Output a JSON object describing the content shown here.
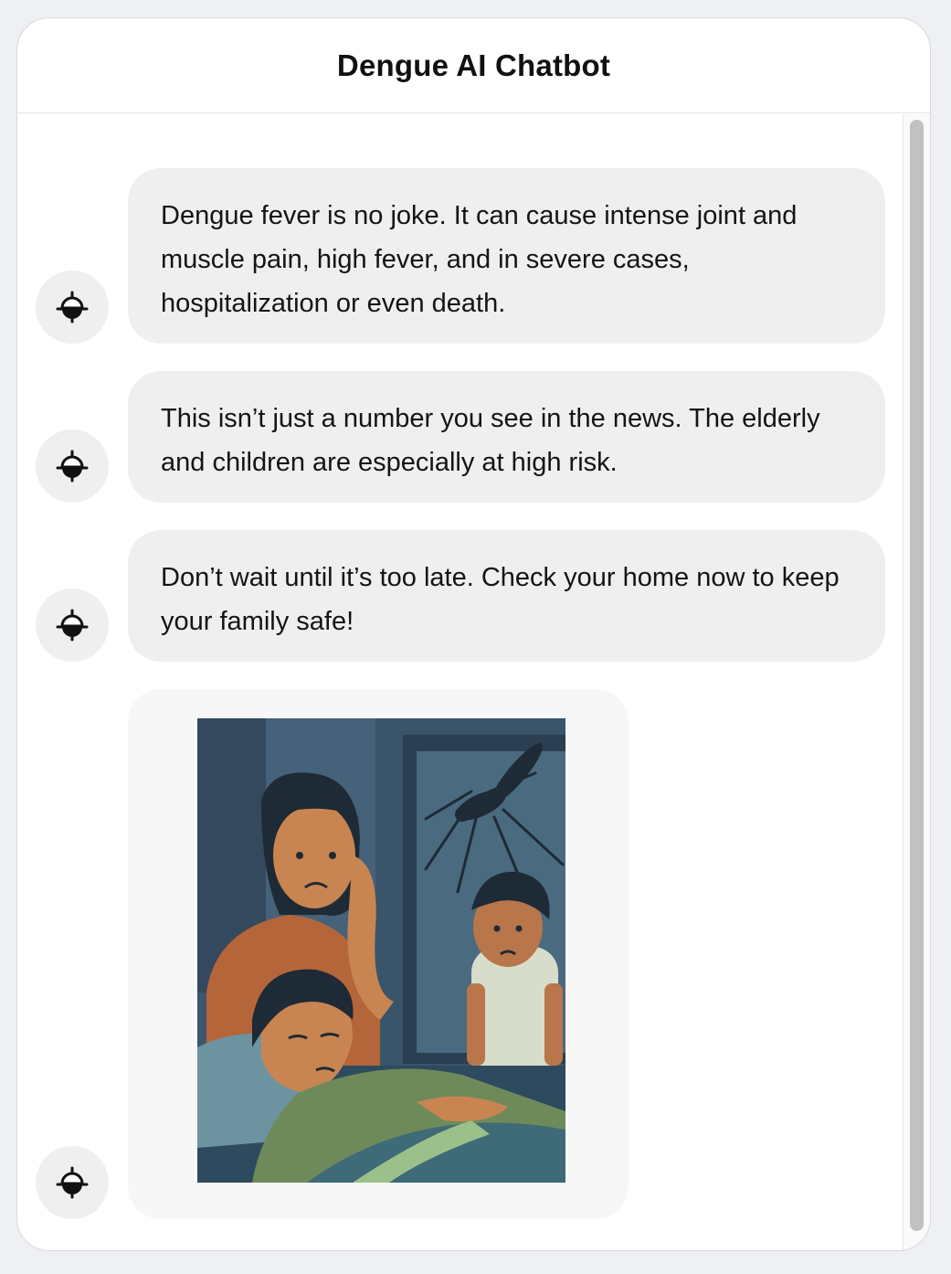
{
  "header": {
    "title": "Dengue AI Chatbot"
  },
  "messages": [
    {
      "type": "text",
      "text": "Dengue fever is no joke. It can cause intense joint and muscle pain, high fever, and in severe cases, hospitalization or even death."
    },
    {
      "type": "text",
      "text": "This isn’t just a number you see in the news. The elderly and children are especially at high risk."
    },
    {
      "type": "text",
      "text": "Don’t wait until it’s too late. Check your home now to keep your family safe!"
    },
    {
      "type": "image"
    }
  ],
  "icons": {
    "bot_avatar": "bot-target-icon"
  },
  "colors": {
    "bubble": "#efefef",
    "image_bubble": "#f7f7f7",
    "scroll_thumb": "#c1c1c1"
  }
}
